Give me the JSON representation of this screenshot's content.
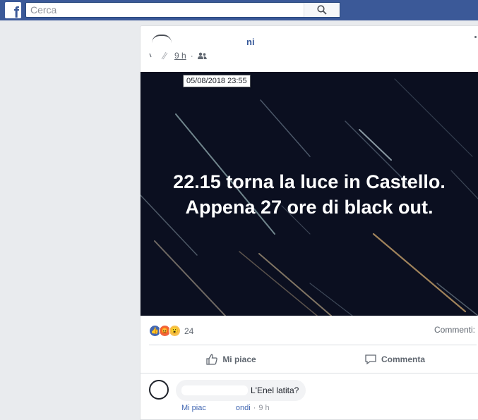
{
  "topbar": {
    "logo_letter": "f",
    "search_placeholder": "Cerca"
  },
  "post": {
    "author_visible": "ni",
    "time": "9 h",
    "tooltip": "05/08/2018 23:55",
    "image_text_line1": "22.15 torna la luce in Castello.",
    "image_text_line2": "Appena 27 ore di black out.",
    "reaction_count": "24",
    "comments_label": "Commenti:",
    "like_label": "Mi piace",
    "comment_label": "Commenta"
  },
  "comment": {
    "text_visible": "L'Enel latita?",
    "like_label": "Mi piac",
    "reply_label": "ondi",
    "separator": "·",
    "age": "9 h"
  },
  "colors": {
    "topbar": "#3b5998",
    "link": "#365899",
    "image_bg": "#0b0f20"
  }
}
